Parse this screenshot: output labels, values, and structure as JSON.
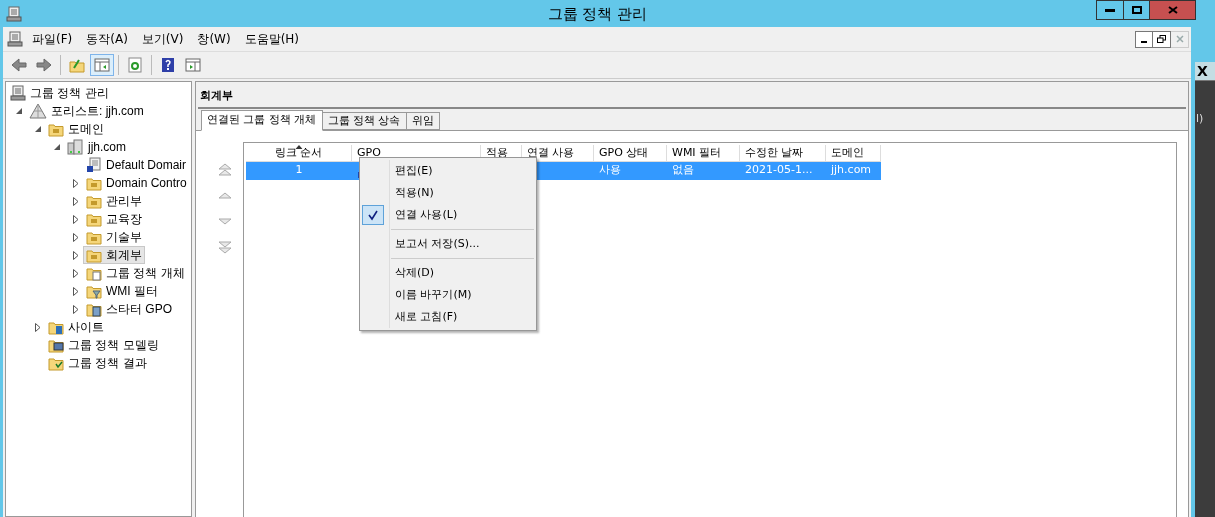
{
  "window": {
    "title": "그룹 정책 관리"
  },
  "menu": [
    "파일(F)",
    "동작(A)",
    "보기(V)",
    "창(W)",
    "도움말(H)"
  ],
  "toolbar": [
    {
      "kind": "back"
    },
    {
      "kind": "forward"
    },
    {
      "kind": "sep"
    },
    {
      "kind": "up"
    },
    {
      "kind": "pane",
      "selected": true
    },
    {
      "kind": "sep"
    },
    {
      "kind": "refresh"
    },
    {
      "kind": "sep"
    },
    {
      "kind": "help"
    },
    {
      "kind": "pane2"
    }
  ],
  "tree": [
    {
      "label": "그룹 정책 관리",
      "kind": "gpm",
      "selected": false,
      "children": [
        {
          "label": "포리스트: jjh.com",
          "kind": "forest",
          "expanded": true,
          "selected": false,
          "children": [
            {
              "label": "도메인",
              "kind": "domains",
              "expanded": true,
              "selected": false,
              "children": [
                {
                  "label": "jjh.com",
                  "kind": "domain",
                  "expanded": true,
                  "selected": false,
                  "children": [
                    {
                      "label": "Default Domair",
                      "kind": "gpo",
                      "selected": false
                    },
                    {
                      "label": "Domain Contro",
                      "kind": "ou",
                      "expanded": false,
                      "selected": false
                    },
                    {
                      "label": "관리부",
                      "kind": "ou",
                      "expanded": false,
                      "selected": false
                    },
                    {
                      "label": "교육장",
                      "kind": "ou",
                      "expanded": false,
                      "selected": false
                    },
                    {
                      "label": "기술부",
                      "kind": "ou",
                      "expanded": false,
                      "selected": false
                    },
                    {
                      "label": "회계부",
                      "kind": "ou",
                      "expanded": false,
                      "selected": true
                    },
                    {
                      "label": "그룹 정책 개체",
                      "kind": "gpofolder",
                      "expanded": false,
                      "selected": false
                    },
                    {
                      "label": "WMI 필터",
                      "kind": "wmi",
                      "expanded": false,
                      "selected": false
                    },
                    {
                      "label": "스타터 GPO",
                      "kind": "starter",
                      "expanded": false,
                      "selected": false
                    }
                  ]
                }
              ]
            },
            {
              "label": "사이트",
              "kind": "sites",
              "expanded": false,
              "selected": false
            },
            {
              "label": "그룹 정책 모델링",
              "kind": "modeling",
              "selected": false
            },
            {
              "label": "그룹 정책 결과",
              "kind": "results",
              "selected": false
            }
          ]
        }
      ]
    }
  ],
  "panel": {
    "title": "회계부",
    "tabs": [
      {
        "label": "연결된 그룹 정책 개체",
        "selected": true
      },
      {
        "label": "그룹 정책 상속",
        "selected": false
      },
      {
        "label": "위임",
        "selected": false
      }
    ],
    "order_buttons": [
      {
        "kind": "top"
      },
      {
        "kind": "up"
      },
      {
        "kind": "down"
      },
      {
        "kind": "bottom"
      }
    ],
    "table": {
      "columns": [
        {
          "label": "링크 순서",
          "sorted": true
        },
        {
          "label": "GPO",
          "sorted": false
        },
        {
          "label": "적용",
          "sorted": false
        },
        {
          "label": "연결 사용",
          "sorted": false
        },
        {
          "label": "GPO 상태",
          "sorted": false
        },
        {
          "label": "WMI 필터",
          "sorted": false
        },
        {
          "label": "수정한 날짜",
          "sorted": false
        },
        {
          "label": "도메인",
          "sorted": false
        }
      ],
      "rows": [
        {
          "selected": true,
          "cells": [
            "1",
            "",
            "",
            "",
            "사용",
            "없음",
            "2021-05-1...",
            "jjh.com"
          ]
        }
      ]
    }
  },
  "context_menu": [
    {
      "kind": "item",
      "label": "편집(E)",
      "checked": false
    },
    {
      "kind": "item",
      "label": "적용(N)",
      "checked": false
    },
    {
      "kind": "item",
      "label": "연결 사용(L)",
      "checked": true
    },
    {
      "kind": "separator"
    },
    {
      "kind": "item",
      "label": "보고서 저장(S)...",
      "checked": false
    },
    {
      "kind": "separator"
    },
    {
      "kind": "item",
      "label": "삭제(D)",
      "checked": false
    },
    {
      "kind": "item",
      "label": "이름 바꾸기(M)",
      "checked": false
    },
    {
      "kind": "item",
      "label": "새로 고침(F)",
      "checked": false
    }
  ],
  "background_window": {
    "close_label": "X",
    "text": "l)"
  }
}
